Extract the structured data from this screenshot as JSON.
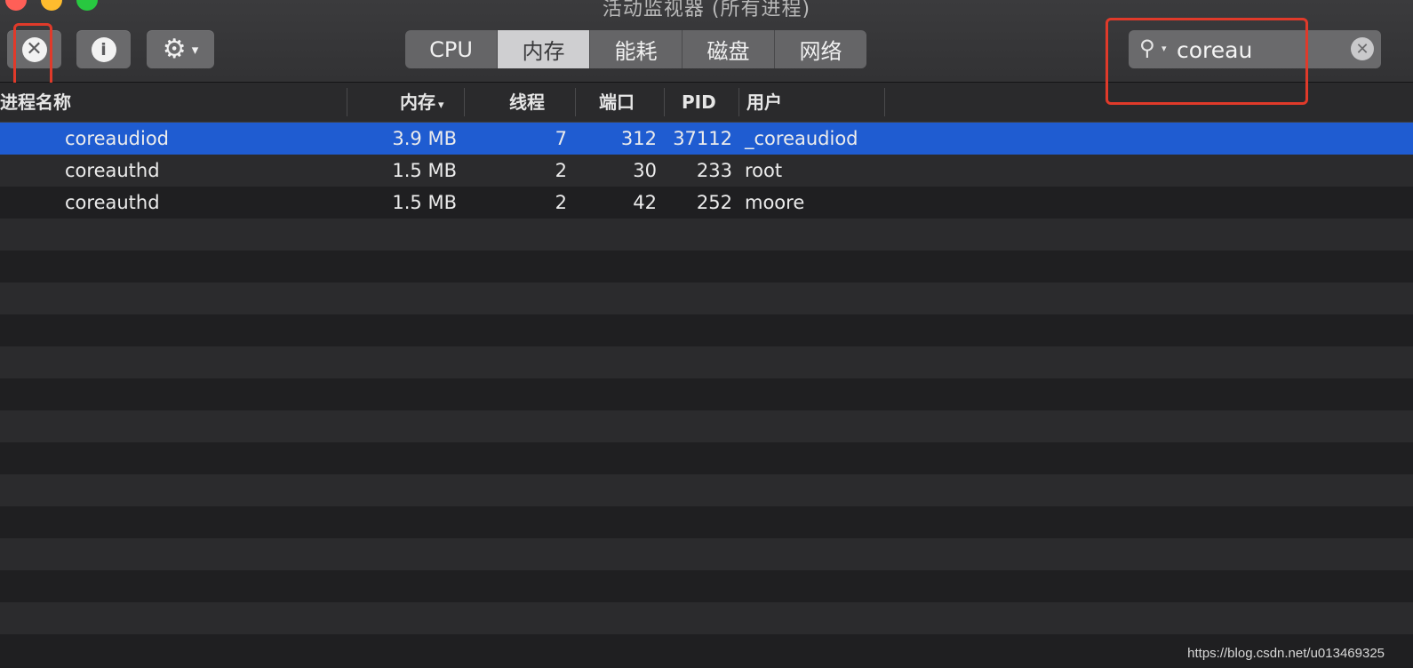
{
  "window": {
    "title": "活动监视器 (所有进程)"
  },
  "toolbar": {
    "stop_icon": "stop-process-icon",
    "info_icon": "info-icon",
    "gear_icon": "gear-icon"
  },
  "tabs": [
    {
      "label": "CPU",
      "active": false
    },
    {
      "label": "内存",
      "active": true
    },
    {
      "label": "能耗",
      "active": false
    },
    {
      "label": "磁盘",
      "active": false
    },
    {
      "label": "网络",
      "active": false
    }
  ],
  "search": {
    "value": "coreau"
  },
  "columns": {
    "name": "进程名称",
    "memory": "内存",
    "threads": "线程",
    "ports": "端口",
    "pid": "PID",
    "user": "用户"
  },
  "rows": [
    {
      "name": "coreaudiod",
      "memory": "3.9 MB",
      "threads": "7",
      "ports": "312",
      "pid": "37112",
      "user": "_coreaudiod",
      "selected": true
    },
    {
      "name": "coreauthd",
      "memory": "1.5 MB",
      "threads": "2",
      "ports": "30",
      "pid": "233",
      "user": "root",
      "selected": false
    },
    {
      "name": "coreauthd",
      "memory": "1.5 MB",
      "threads": "2",
      "ports": "42",
      "pid": "252",
      "user": "moore",
      "selected": false
    }
  ],
  "colors": {
    "selection": "#1f5cd1",
    "annotation": "#e03a2a"
  },
  "watermark": "https://blog.csdn.net/u013469325"
}
